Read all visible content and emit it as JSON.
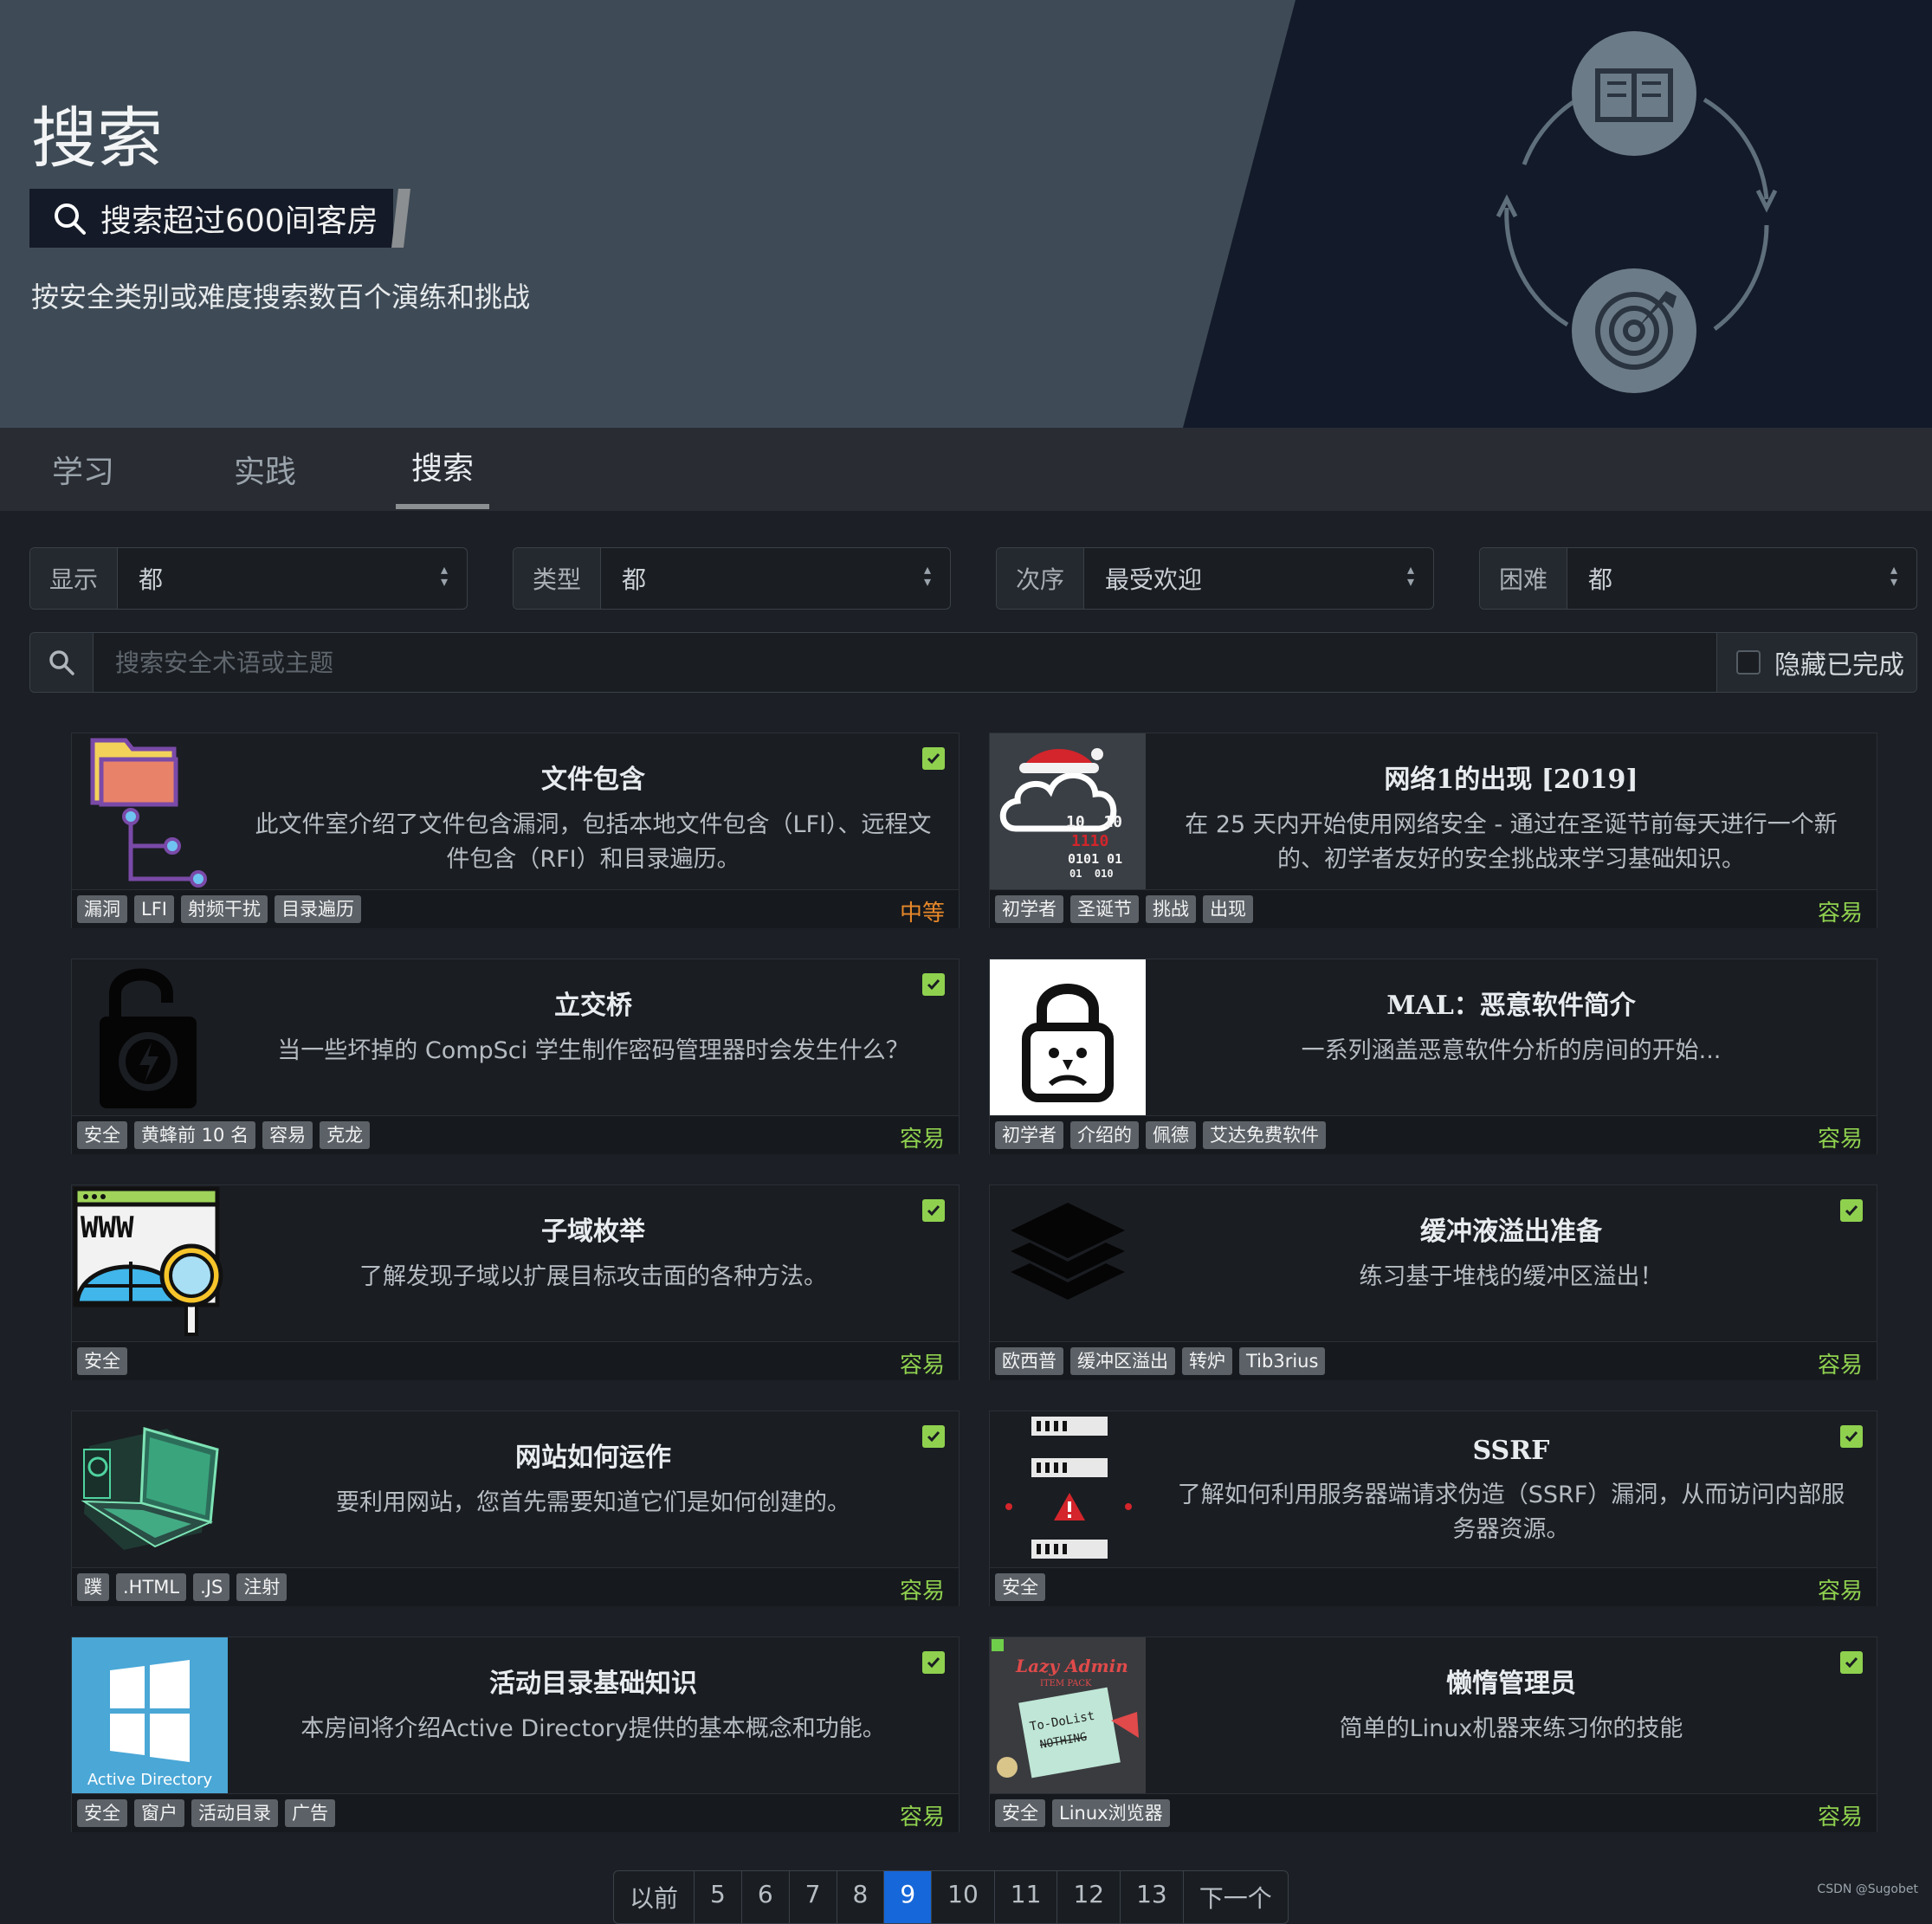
{
  "hero": {
    "title": "搜索",
    "badge": "搜索超过600间客房",
    "subtitle": "按安全类别或难度搜索数百个演练和挑战"
  },
  "tabs": [
    {
      "label": "学习",
      "active": false
    },
    {
      "label": "实践",
      "active": false
    },
    {
      "label": "搜索",
      "active": true
    }
  ],
  "filters": [
    {
      "label": "显示",
      "value": "都"
    },
    {
      "label": "类型",
      "value": "都"
    },
    {
      "label": "次序",
      "value": "最受欢迎"
    },
    {
      "label": "困难",
      "value": "都"
    }
  ],
  "search": {
    "placeholder": "搜索安全术语或主题",
    "hide_completed_label": "隐藏已完成"
  },
  "colors": {
    "easy": "#8fd14f",
    "medium": "#e7882a",
    "accent": "#1667d9",
    "check": "#8fd14f"
  },
  "rooms": [
    {
      "title": "文件包含",
      "desc": "此文件室介绍了文件包含漏洞，包括本地文件包含（LFI）、远程文件包含（RFI）和目录遍历。",
      "tags": [
        "漏洞",
        "LFI",
        "射频干扰",
        "目录遍历"
      ],
      "difficulty": "中等",
      "level": "medium",
      "completed": true,
      "icon": "folder-tree-icon"
    },
    {
      "title": "网络1的出现 [2019]",
      "desc": "在 25 天内开始使用网络安全 - 通过在圣诞节前每天进行一个新的、初学者友好的安全挑战来学习基础知识。",
      "tags": [
        "初学者",
        "圣诞节",
        "挑战",
        "出现"
      ],
      "difficulty": "容易",
      "level": "easy",
      "completed": false,
      "icon": "cloud-santa-icon",
      "thumb_bits": [
        "10  10",
        "1110",
        "0101 01",
        "01  010"
      ]
    },
    {
      "title": "立交桥",
      "desc": "当一些坏掉的 CompSci 学生制作密码管理器时会发生什么？",
      "tags": [
        "安全",
        "黄蜂前 10 名",
        "容易",
        "克龙"
      ],
      "difficulty": "容易",
      "level": "easy",
      "completed": true,
      "icon": "padlock-bolt-icon"
    },
    {
      "title": "MAL：恶意软件简介",
      "desc": "一系列涵盖恶意软件分析的房间的开始...",
      "tags": [
        "初学者",
        "介绍的",
        "佩德",
        "艾达免费软件"
      ],
      "difficulty": "容易",
      "level": "easy",
      "completed": false,
      "icon": "sad-lock-icon"
    },
    {
      "title": "子域枚举",
      "desc": "了解发现子域以扩展目标攻击面的各种方法。",
      "tags": [
        "安全"
      ],
      "difficulty": "容易",
      "level": "easy",
      "completed": true,
      "icon": "www-magnifier-icon",
      "thumb_text": "WWW"
    },
    {
      "title": "缓冲液溢出准备",
      "desc": "练习基于堆栈的缓冲区溢出！",
      "tags": [
        "欧西普",
        "缓冲区溢出",
        "转炉",
        "Tib3rius"
      ],
      "difficulty": "容易",
      "level": "easy",
      "completed": true,
      "icon": "layers-icon"
    },
    {
      "title": "网站如何运作",
      "desc": "要利用网站，您首先需要知道它们是如何创建的。",
      "tags": [
        "蹼",
        ".HTML",
        ".JS",
        "注射"
      ],
      "difficulty": "容易",
      "level": "easy",
      "completed": true,
      "icon": "laptop-icon"
    },
    {
      "title": "SSRF",
      "desc": "了解如何利用服务器端请求伪造（SSRF）漏洞，从而访问内部服务器资源。",
      "tags": [
        "安全"
      ],
      "difficulty": "容易",
      "level": "easy",
      "completed": true,
      "icon": "servers-warning-icon"
    },
    {
      "title": "活动目录基础知识",
      "desc": "本房间将介绍Active Directory提供的基本概念和功能。",
      "tags": [
        "安全",
        "窗户",
        "活动目录",
        "广告"
      ],
      "difficulty": "容易",
      "level": "easy",
      "completed": true,
      "icon": "windows-logo-icon",
      "thumb_text": "Active Directory"
    },
    {
      "title": "懒惰管理员",
      "desc": "简单的Linux机器来练习你的技能",
      "tags": [
        "安全",
        "Linux浏览器"
      ],
      "difficulty": "容易",
      "level": "easy",
      "completed": true,
      "icon": "lazy-admin-icon",
      "thumb_lines": [
        "Lazy Admin",
        "ITEM PACK",
        "To-DoList",
        "NOTHING"
      ]
    }
  ],
  "pagination": {
    "prev": "以前",
    "pages": [
      "5",
      "6",
      "7",
      "8",
      "9",
      "10",
      "11",
      "12",
      "13"
    ],
    "current": "9",
    "next": "下一个"
  },
  "watermark": "CSDN @Sugobet"
}
